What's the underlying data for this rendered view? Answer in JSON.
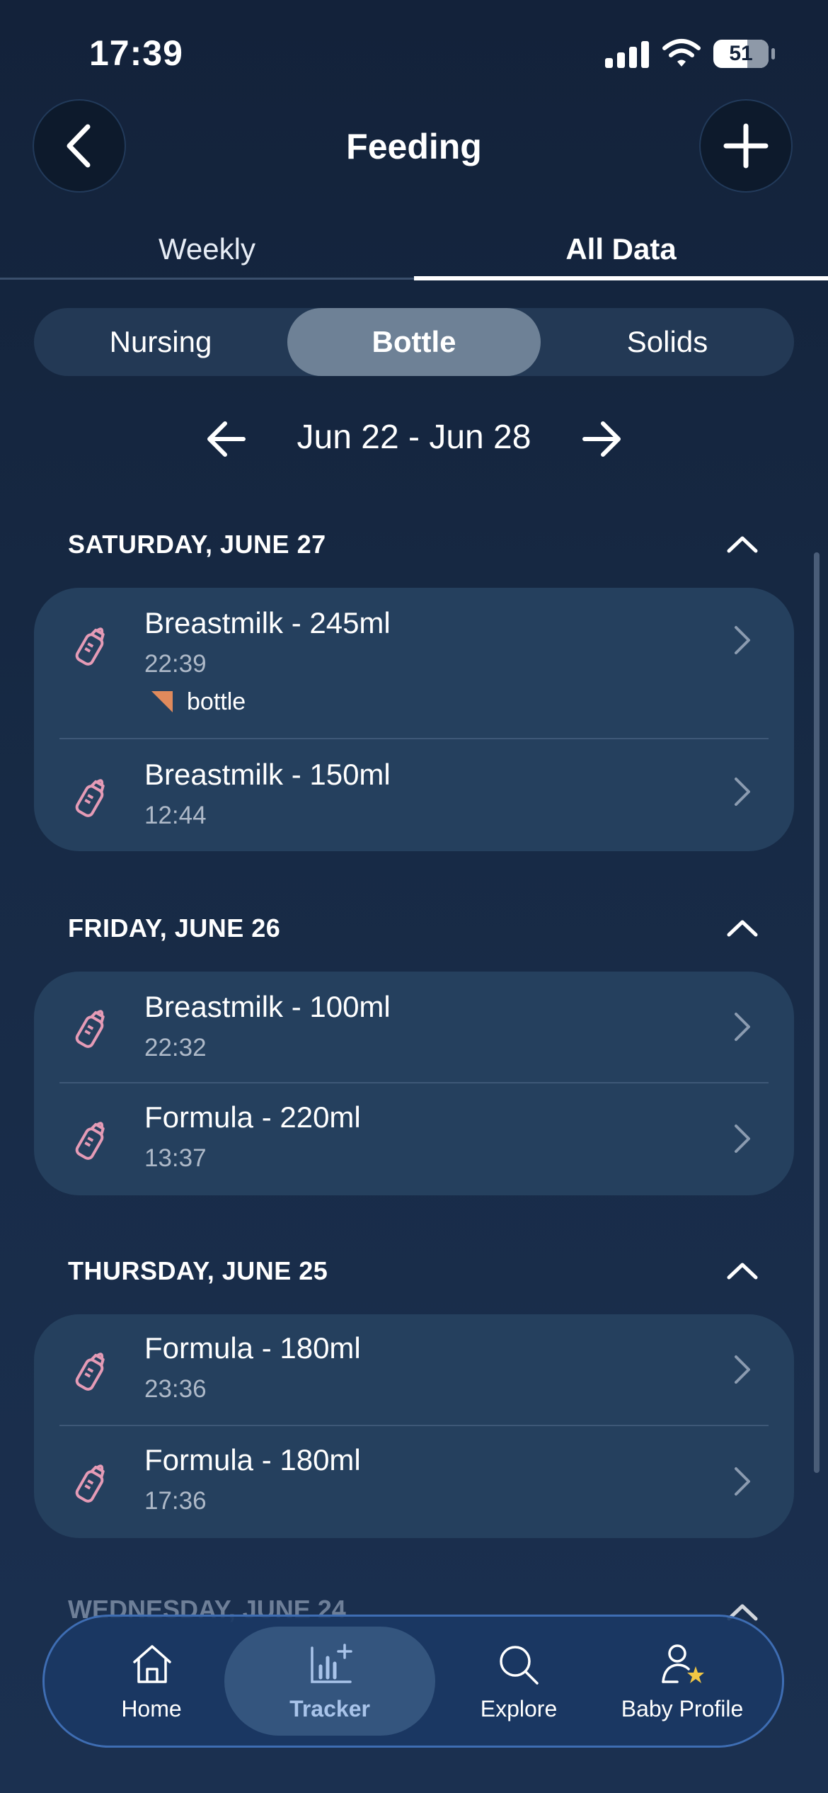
{
  "status_bar": {
    "time": "17:39",
    "battery": "51"
  },
  "header": {
    "title": "Feeding",
    "back_icon": "chevron-left-icon",
    "add_icon": "plus-icon"
  },
  "tabs": [
    {
      "label": "Weekly",
      "active": false
    },
    {
      "label": "All Data",
      "active": true
    }
  ],
  "segments": [
    {
      "label": "Nursing",
      "active": false
    },
    {
      "label": "Bottle",
      "active": true
    },
    {
      "label": "Solids",
      "active": false
    }
  ],
  "date_range": {
    "label": "Jun 22 - Jun 28"
  },
  "days": [
    {
      "header": "SATURDAY, JUNE 27",
      "entries": [
        {
          "title": "Breastmilk - 245ml",
          "time": "22:39",
          "note": "bottle"
        },
        {
          "title": "Breastmilk - 150ml",
          "time": "12:44"
        }
      ]
    },
    {
      "header": "FRIDAY, JUNE 26",
      "entries": [
        {
          "title": "Breastmilk - 100ml",
          "time": "22:32"
        },
        {
          "title": "Formula - 220ml",
          "time": "13:37"
        }
      ]
    },
    {
      "header": "THURSDAY, JUNE 25",
      "entries": [
        {
          "title": "Formula - 180ml",
          "time": "23:36"
        },
        {
          "title": "Formula - 180ml",
          "time": "17:36"
        }
      ]
    },
    {
      "header": "WEDNESDAY, JUNE 24"
    }
  ],
  "bottom_nav": [
    {
      "label": "Home",
      "icon": "home-icon",
      "active": false
    },
    {
      "label": "Tracker",
      "icon": "chart-plus-icon",
      "active": true
    },
    {
      "label": "Explore",
      "icon": "search-icon",
      "active": false
    },
    {
      "label": "Baby Profile",
      "icon": "baby-profile-icon",
      "active": false
    }
  ],
  "colors": {
    "background": "#172a45",
    "card": "#25405e",
    "bottle_icon": "#e59bb6",
    "note_flag": "#e08a5c",
    "active_segment": "#6e8196",
    "nav_border": "#3e6db3"
  }
}
